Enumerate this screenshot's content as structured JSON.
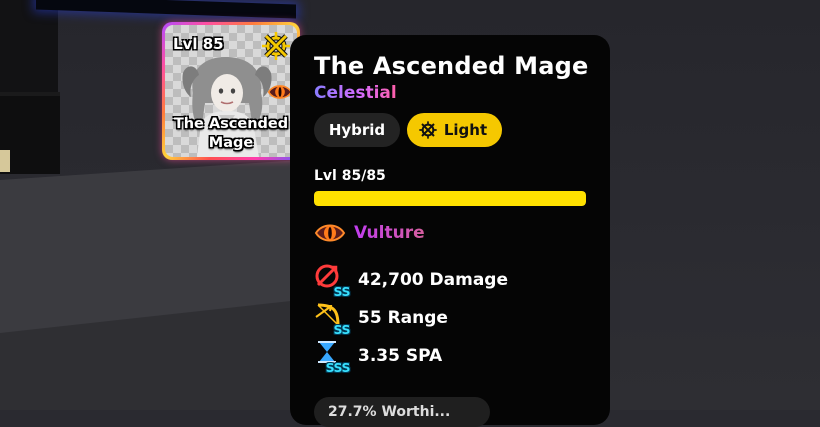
{
  "unit_card": {
    "level": "Lvl 85",
    "name": "The Ascended Mage",
    "element_icon": "light-element-icon",
    "trait_icon": "vulture-eye-icon"
  },
  "info": {
    "title": "The Ascended Mage",
    "rarity": "Celestial",
    "tags": [
      {
        "label": "Hybrid"
      },
      {
        "label": "Light",
        "icon": "light-element-icon"
      }
    ],
    "level": {
      "label": "Lvl 85/85",
      "current": 85,
      "max": 85
    },
    "trait": {
      "name": "Vulture",
      "icon": "vulture-eye-icon"
    },
    "stats": [
      {
        "text": "42,700 Damage",
        "grade": "SS",
        "icon": "damage-icon"
      },
      {
        "text": "55 Range",
        "grade": "SS",
        "icon": "range-bow-icon"
      },
      {
        "text": "3.35 SPA",
        "grade": "SSS",
        "icon": "spa-hourglass-icon"
      }
    ],
    "worth_partial": "27.7% Worthi..."
  },
  "colors": {
    "panel_bg": "#050505",
    "light_tag": "#f5c800",
    "level_bar": "#ffe100",
    "grade_cyan": "#38e0ff",
    "rarity_gradient": [
      "#8a7dff",
      "#d46bff",
      "#ff5fa8"
    ]
  }
}
